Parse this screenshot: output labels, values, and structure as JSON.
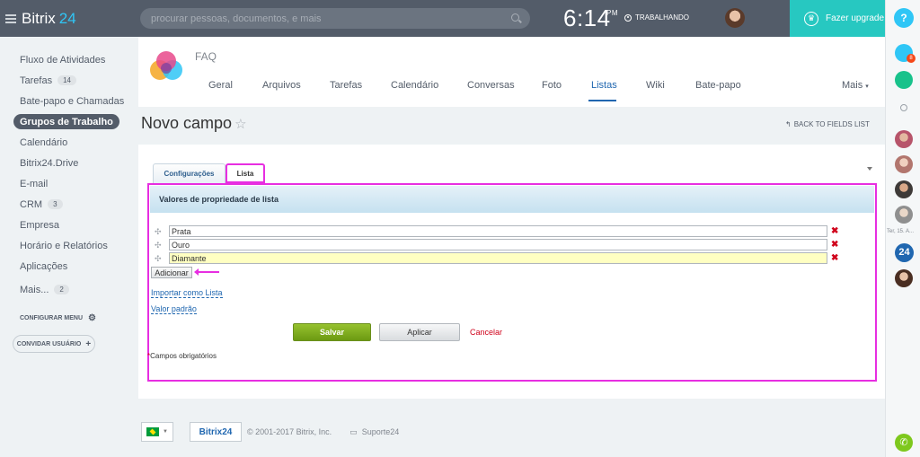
{
  "app": {
    "name": "Bitrix",
    "version": "24"
  },
  "search": {
    "placeholder": "procurar pessoas, documentos, e mais"
  },
  "clock": {
    "time": "6:14",
    "ampm": "PM",
    "status": "TRABALHANDO"
  },
  "upgrade": {
    "label": "Fazer upgrade"
  },
  "help": {
    "label": "?"
  },
  "sidebar": {
    "items": [
      {
        "label": "Fluxo de Atividades"
      },
      {
        "label": "Tarefas",
        "badge": "14"
      },
      {
        "label": "Bate-papo e Chamadas"
      },
      {
        "label": "Grupos de Trabalho"
      },
      {
        "label": "Calendário"
      },
      {
        "label": "Bitrix24.Drive"
      },
      {
        "label": "E-mail"
      },
      {
        "label": "CRM",
        "badge": "3"
      },
      {
        "label": "Empresa"
      },
      {
        "label": "Horário e Relatórios"
      },
      {
        "label": "Aplicações"
      },
      {
        "label": "Mais...",
        "badge": "2"
      }
    ],
    "config_menu": "CONFIGURAR MENU",
    "invite": "CONVIDAR USUÁRIO"
  },
  "group": {
    "title": "FAQ",
    "tabs": [
      "Geral",
      "Arquivos",
      "Tarefas",
      "Calendário",
      "Conversas",
      "Foto",
      "Listas",
      "Wiki",
      "Bate-papo",
      "Mais"
    ],
    "active_tab": "Listas"
  },
  "page": {
    "title": "Novo campo",
    "back_link": "BACK TO FIELDS LIST"
  },
  "form": {
    "tabs": [
      "Configurações",
      "Lista"
    ],
    "section_title": "Valores de propriedade de lista",
    "values": [
      "Prata",
      "Ouro",
      "Diamante"
    ],
    "add_label": "Adicionar",
    "import_label": "Importar como Lista",
    "default_label": "Valor padrão",
    "save_label": "Salvar",
    "apply_label": "Aplicar",
    "cancel_label": "Cancelar",
    "required_note": "Campos obrigatórios"
  },
  "footer": {
    "brand": "Bitrix24",
    "copyright": "© 2001-2017 Bitrix, Inc.",
    "support": "Suporte24"
  },
  "right_column": {
    "notification_count": "8",
    "avatar_label": "Ter, 15. A...",
    "b24_label": "24"
  },
  "colors": {
    "accent": "#2fc6f6",
    "highlight": "#e72ee1",
    "upgrade": "#27c8c1",
    "save": "#7fb021"
  }
}
